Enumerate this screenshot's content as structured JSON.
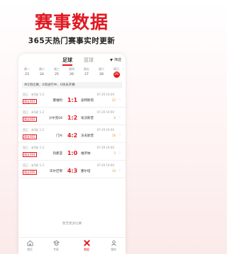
{
  "hero": {
    "title": "赛事数据",
    "subtitle": "365天热门赛事实时更新"
  },
  "topbar": {
    "tab_active": "足球",
    "tab_inactive": "篮球",
    "filter_label": "筛选"
  },
  "dates": [
    {
      "weekday": "周一",
      "day": "23"
    },
    {
      "weekday": "周二",
      "day": "24"
    },
    {
      "weekday": "周三",
      "day": "25"
    },
    {
      "weekday": "周四",
      "day": "26"
    },
    {
      "weekday": "周五",
      "day": "27"
    },
    {
      "weekday": "周六",
      "day": "28"
    },
    {
      "weekday": "周日",
      "day": "29",
      "selected": true
    }
  ],
  "summary": "共5场比赛，0场进行中，0场未开赛",
  "matches": [
    {
      "league": "西乙 · 未5轮 1-2",
      "time": "07-29 19:00",
      "code": "周五001",
      "home": "塞维利",
      "score": "1:1",
      "away": "迪特斯塔",
      "corner": "22"
    },
    {
      "league": "西乙 · 未5轮 1-2",
      "time": "07-29 19:00",
      "code": "周五002",
      "home": "沙尔克04",
      "score": "1:2",
      "away": "埃沃斯堡",
      "corner": "6"
    },
    {
      "league": "西乙 · 未5轮 1-2",
      "time": "07-29 19:00",
      "code": "周五003",
      "home": "门兴",
      "score": "4:2",
      "away": "沃夫斯堡",
      "corner": "16"
    },
    {
      "league": "西乙 · 未5轮 1-2",
      "time": "07-29 19:00",
      "code": "周五004",
      "home": "热那亚",
      "score": "1:0",
      "away": "维罗纳",
      "corner": "5"
    },
    {
      "league": "西乙 · 未5轮 1-2",
      "time": "07-29 19:00",
      "code": "周五005",
      "home": "毕尔巴鄂",
      "score": "4:3",
      "away": "塞尔塔",
      "corner": "14"
    }
  ],
  "no_more": "暂无更多比赛",
  "nav": [
    {
      "label": "首页",
      "icon": "home-icon"
    },
    {
      "label": "专家",
      "icon": "expert-icon"
    },
    {
      "label": "数据",
      "icon": "data-icon",
      "active": true
    },
    {
      "label": "我的",
      "icon": "profile-icon"
    }
  ],
  "colors": {
    "accent": "#e01922",
    "corner": "#e8902a"
  }
}
